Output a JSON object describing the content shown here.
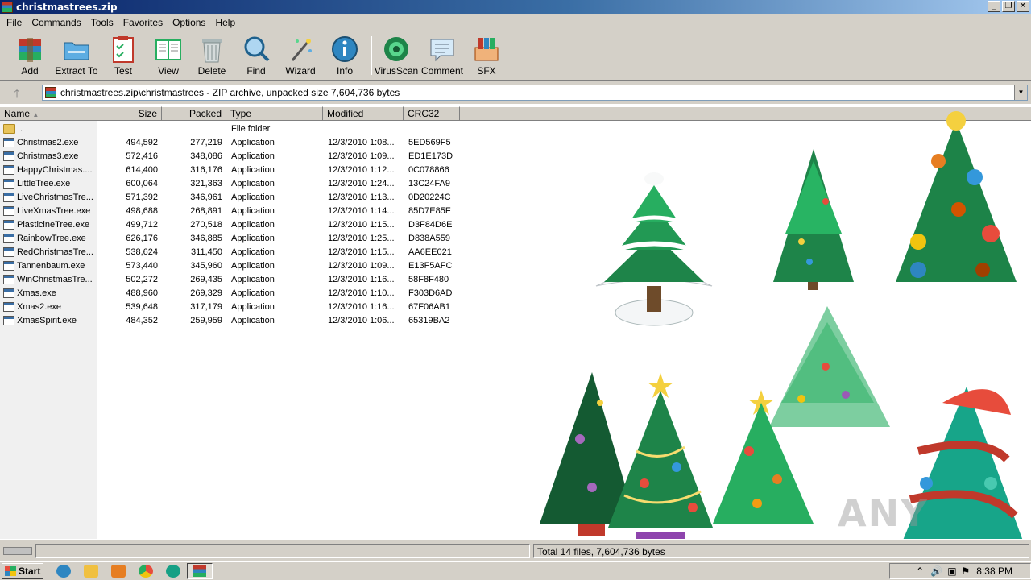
{
  "window": {
    "title": "christmastrees.zip"
  },
  "menu": [
    "File",
    "Commands",
    "Tools",
    "Favorites",
    "Options",
    "Help"
  ],
  "toolbar": [
    {
      "label": "Add",
      "icon": "add-archive-icon"
    },
    {
      "label": "Extract To",
      "icon": "extract-folder-icon"
    },
    {
      "label": "Test",
      "icon": "test-clipboard-icon"
    },
    {
      "label": "View",
      "icon": "view-book-icon"
    },
    {
      "label": "Delete",
      "icon": "trash-icon"
    },
    {
      "label": "Find",
      "icon": "magnifier-icon"
    },
    {
      "label": "Wizard",
      "icon": "wand-icon"
    },
    {
      "label": "Info",
      "icon": "info-icon"
    },
    {
      "label": "VirusScan",
      "icon": "virus-icon"
    },
    {
      "label": "Comment",
      "icon": "comment-icon"
    },
    {
      "label": "SFX",
      "icon": "sfx-box-icon"
    }
  ],
  "address": "christmastrees.zip\\christmastrees - ZIP archive, unpacked size 7,604,736 bytes",
  "columns": {
    "name": "Name",
    "size": "Size",
    "packed": "Packed",
    "type": "Type",
    "modified": "Modified",
    "crc": "CRC32"
  },
  "files": [
    {
      "name": "..",
      "size": "",
      "packed": "",
      "type": "File folder",
      "modified": "",
      "crc": "",
      "folder": true
    },
    {
      "name": "Christmas2.exe",
      "size": "494,592",
      "packed": "277,219",
      "type": "Application",
      "modified": "12/3/2010 1:08...",
      "crc": "5ED569F5"
    },
    {
      "name": "Christmas3.exe",
      "size": "572,416",
      "packed": "348,086",
      "type": "Application",
      "modified": "12/3/2010 1:09...",
      "crc": "ED1E173D"
    },
    {
      "name": "HappyChristmas....",
      "size": "614,400",
      "packed": "316,176",
      "type": "Application",
      "modified": "12/3/2010 1:12...",
      "crc": "0C078866"
    },
    {
      "name": "LittleTree.exe",
      "size": "600,064",
      "packed": "321,363",
      "type": "Application",
      "modified": "12/3/2010 1:24...",
      "crc": "13C24FA9"
    },
    {
      "name": "LiveChristmasTre...",
      "size": "571,392",
      "packed": "346,961",
      "type": "Application",
      "modified": "12/3/2010 1:13...",
      "crc": "0D20224C"
    },
    {
      "name": "LiveXmasTree.exe",
      "size": "498,688",
      "packed": "268,891",
      "type": "Application",
      "modified": "12/3/2010 1:14...",
      "crc": "85D7E85F"
    },
    {
      "name": "PlasticineTree.exe",
      "size": "499,712",
      "packed": "270,518",
      "type": "Application",
      "modified": "12/3/2010 1:15...",
      "crc": "D3F84D6E"
    },
    {
      "name": "RainbowTree.exe",
      "size": "626,176",
      "packed": "346,885",
      "type": "Application",
      "modified": "12/3/2010 1:25...",
      "crc": "D838A559"
    },
    {
      "name": "RedChristmasTre...",
      "size": "538,624",
      "packed": "311,450",
      "type": "Application",
      "modified": "12/3/2010 1:15...",
      "crc": "AA6EE021"
    },
    {
      "name": "Tannenbaum.exe",
      "size": "573,440",
      "packed": "345,960",
      "type": "Application",
      "modified": "12/3/2010 1:09...",
      "crc": "E13F5AFC"
    },
    {
      "name": "WinChristmasTre...",
      "size": "502,272",
      "packed": "269,435",
      "type": "Application",
      "modified": "12/3/2010 1:16...",
      "crc": "58F8F480"
    },
    {
      "name": "Xmas.exe",
      "size": "488,960",
      "packed": "269,329",
      "type": "Application",
      "modified": "12/3/2010 1:10...",
      "crc": "F303D6AD"
    },
    {
      "name": "Xmas2.exe",
      "size": "539,648",
      "packed": "317,179",
      "type": "Application",
      "modified": "12/3/2010 1:16...",
      "crc": "67F06AB1"
    },
    {
      "name": "XmasSpirit.exe",
      "size": "484,352",
      "packed": "259,959",
      "type": "Application",
      "modified": "12/3/2010 1:06...",
      "crc": "65319BA2"
    }
  ],
  "status": {
    "total": "Total 14 files, 7,604,736 bytes"
  },
  "taskbar": {
    "start": "Start",
    "clock": "8:38 PM"
  },
  "watermark": "ANY RUN"
}
